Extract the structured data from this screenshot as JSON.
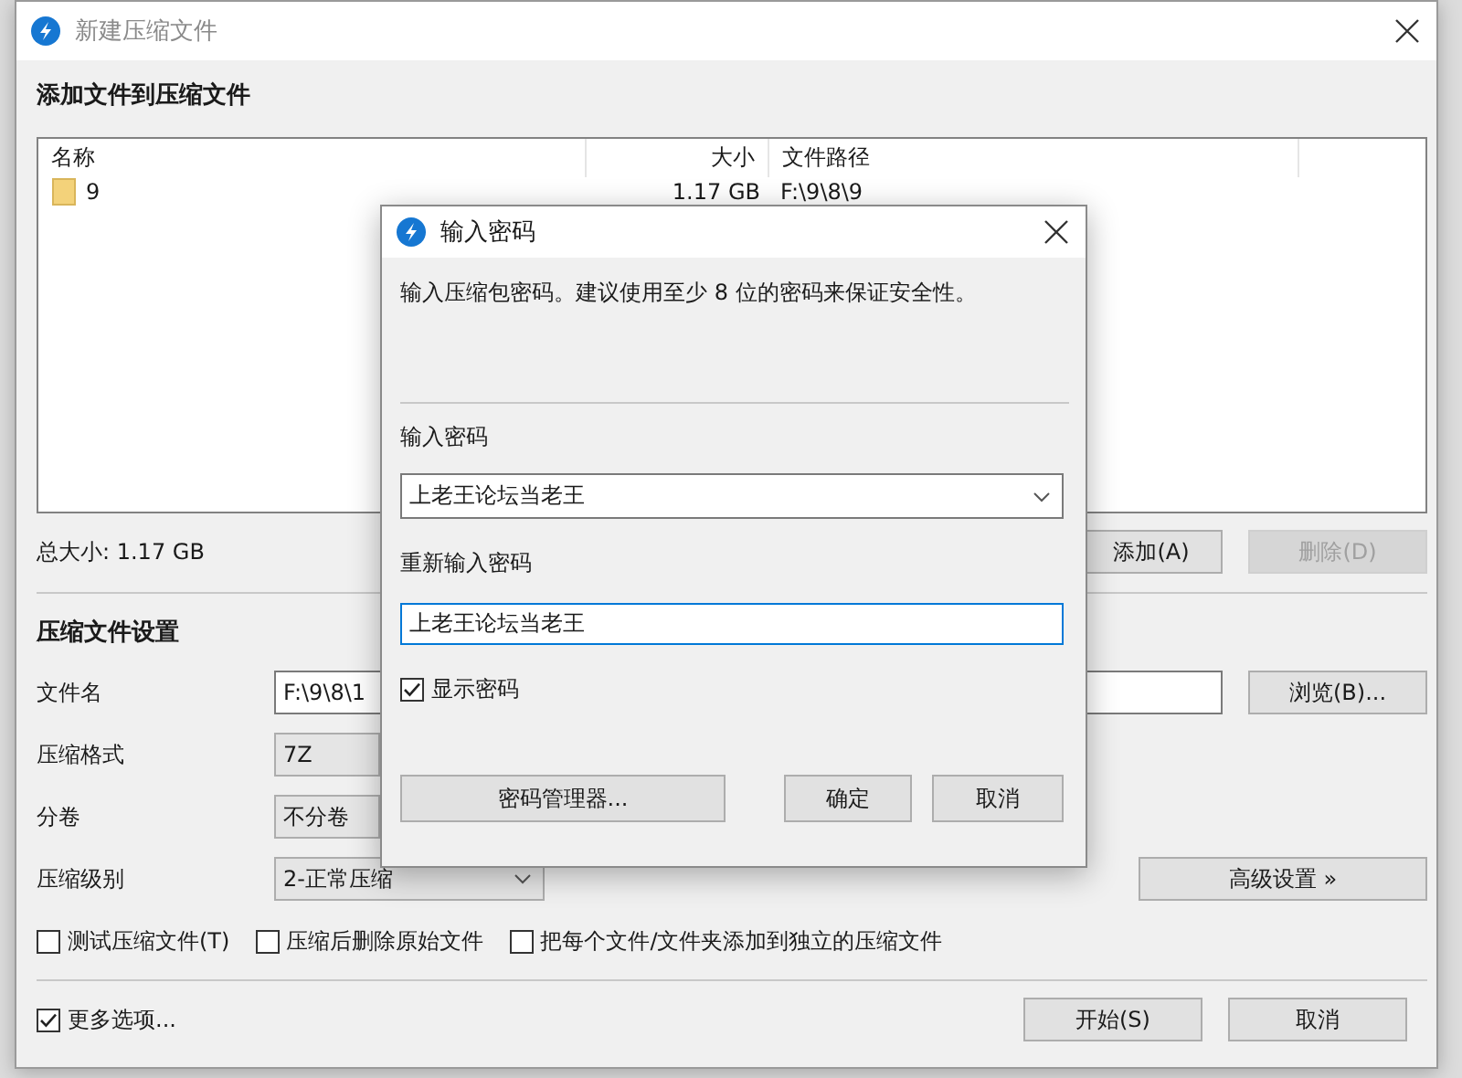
{
  "main_window": {
    "title": "新建压缩文件",
    "heading": "添加文件到压缩文件",
    "file_list": {
      "columns": [
        "名称",
        "大小",
        "文件路径"
      ],
      "rows": [
        {
          "name": "9",
          "size": "1.17 GB",
          "path": "F:\\9\\8\\9"
        }
      ]
    },
    "total_size": "总大小: 1.17 GB",
    "list_buttons": [
      {
        "label": "添加(A)",
        "disabled": false
      },
      {
        "label": "删除(D)",
        "disabled": true
      }
    ],
    "settings_heading": "压缩文件设置",
    "fields": [
      {
        "kind": "text",
        "label": "文件名",
        "value": "F:\\9\\8\\1",
        "button": "浏览(B)..."
      },
      {
        "kind": "select",
        "label": "压缩格式",
        "value": "7Z"
      },
      {
        "kind": "select",
        "label": "分卷",
        "value": "不分卷"
      },
      {
        "kind": "select",
        "label": "压缩级别",
        "value": "2-正常压缩",
        "button": "高级设置 »"
      }
    ],
    "options": [
      {
        "label": "测试压缩文件(T)",
        "checked": false
      },
      {
        "label": "压缩后删除原始文件",
        "checked": false
      },
      {
        "label": "把每个文件/文件夹添加到独立的压缩文件",
        "checked": false
      }
    ],
    "more_options": {
      "label": "更多选项...",
      "checked": true
    },
    "footer_buttons": [
      "开始(S)",
      "取消"
    ]
  },
  "password_dialog": {
    "title": "输入密码",
    "hint": "输入压缩包密码。建议使用至少 8 位的密码来保证安全性。",
    "password_label": "输入密码",
    "password": "上老王论坛当老王",
    "confirm_label": "重新输入密码",
    "confirm": "上老王论坛当老王",
    "show_password": {
      "label": "显示密码",
      "checked": true
    },
    "manager_button": "密码管理器...",
    "buttons": [
      "确定",
      "取消"
    ]
  }
}
